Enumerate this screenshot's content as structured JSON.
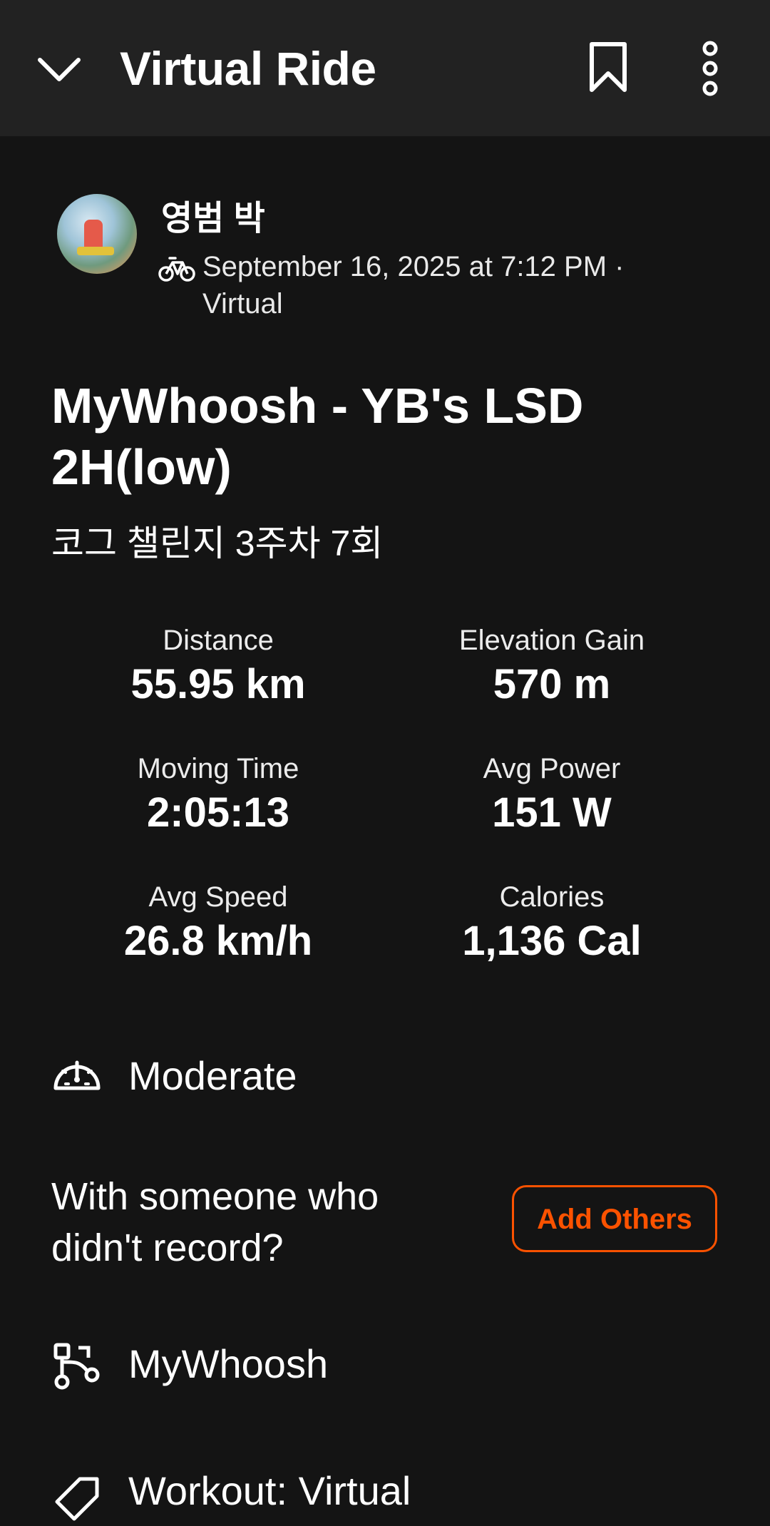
{
  "header": {
    "title": "Virtual Ride",
    "back_icon": "chevron-down-icon",
    "bookmark_icon": "bookmark-icon",
    "more_icon": "more-vertical-icon"
  },
  "activity": {
    "athlete_name": "영범 박",
    "datetime": "September 16, 2025 at 7:12 PM ·",
    "location_type": "Virtual",
    "sport_icon": "bike-icon",
    "title": "MyWhoosh - YB's LSD 2H(low)",
    "description": "코그 챌린지 3주차 7회"
  },
  "stats": [
    {
      "label": "Distance",
      "value": "55.95 km"
    },
    {
      "label": "Elevation Gain",
      "value": "570 m"
    },
    {
      "label": "Moving Time",
      "value": "2:05:13"
    },
    {
      "label": "Avg Power",
      "value": "151 W"
    },
    {
      "label": "Avg Speed",
      "value": "26.8 km/h"
    },
    {
      "label": "Calories",
      "value": "1,136 Cal"
    }
  ],
  "effort": {
    "icon": "speedometer-icon",
    "label": "Moderate"
  },
  "group": {
    "prompt": "With someone who didn't record?",
    "button_label": "Add Others"
  },
  "device": {
    "icon": "route-device-icon",
    "label": "MyWhoosh"
  },
  "workout": {
    "icon": "tag-icon",
    "label": "Workout: Virtual"
  },
  "colors": {
    "accent": "#fc5200",
    "background": "#141414",
    "header": "#222222"
  }
}
